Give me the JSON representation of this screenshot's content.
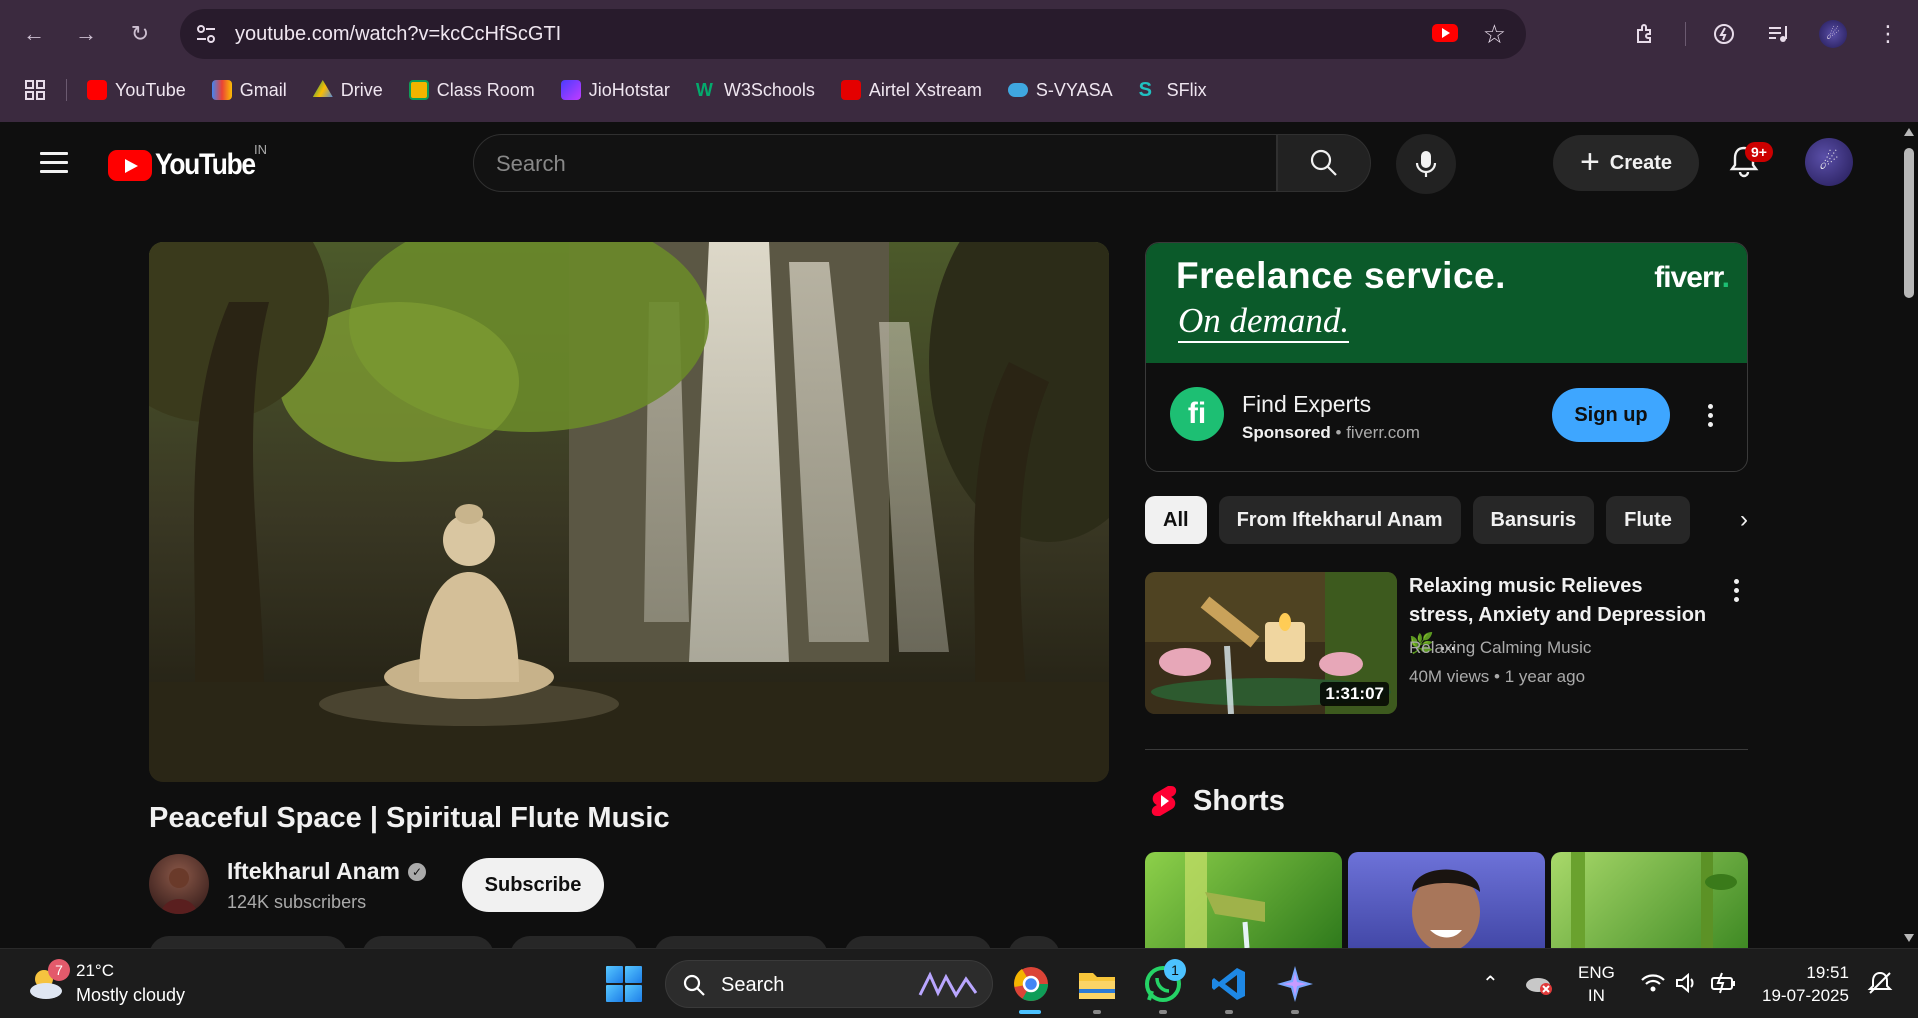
{
  "browser": {
    "url": "youtube.com/watch?v=kcCcHfScGTI",
    "bookmarks": [
      {
        "label": "YouTube",
        "color": "#ff0000"
      },
      {
        "label": "Gmail",
        "color": "#ea4335"
      },
      {
        "label": "Drive",
        "color": "#fbbc04"
      },
      {
        "label": "Class Room",
        "color": "#f4b400"
      },
      {
        "label": "JioHotstar",
        "color": "#4a3cff"
      },
      {
        "label": "W3Schools",
        "color": "#04aa6d"
      },
      {
        "label": "Airtel Xstream",
        "color": "#e40000"
      },
      {
        "label": "S-VYASA",
        "color": "#3fa7e0"
      },
      {
        "label": "SFlix",
        "color": "#20c1c1"
      }
    ]
  },
  "header": {
    "logo_text": "YouTube",
    "country": "IN",
    "search_placeholder": "Search",
    "create_label": "Create",
    "notifications": "9+"
  },
  "video": {
    "title": "Peaceful Space | Spiritual Flute Music",
    "channel": "Iftekharul Anam",
    "subscribers": "124K subscribers",
    "subscribe_label": "Subscribe"
  },
  "ad": {
    "headline": "Freelance service.",
    "subline": "On demand.",
    "brand": "fiverr",
    "brand_dot": ".",
    "title": "Find Experts",
    "sponsored": "Sponsored",
    "domain": "fiverr.com",
    "cta": "Sign up"
  },
  "chips": [
    "All",
    "From Iftekharul Anam",
    "Bansuris",
    "Flute"
  ],
  "recommended": {
    "title": "Relaxing music Relieves stress, Anxiety and Depression 🌿 ...",
    "channel": "Relaxing Calming Music",
    "views": "40M views • 1 year ago",
    "duration": "1:31:07"
  },
  "shorts": {
    "title": "Shorts"
  },
  "taskbar": {
    "weather_badge": "7",
    "temperature": "21°C",
    "condition": "Mostly cloudy",
    "search_label": "Search",
    "whatsapp_badge": "1",
    "lang_line1": "ENG",
    "lang_line2": "IN",
    "time": "19:51",
    "date": "19-07-2025"
  }
}
